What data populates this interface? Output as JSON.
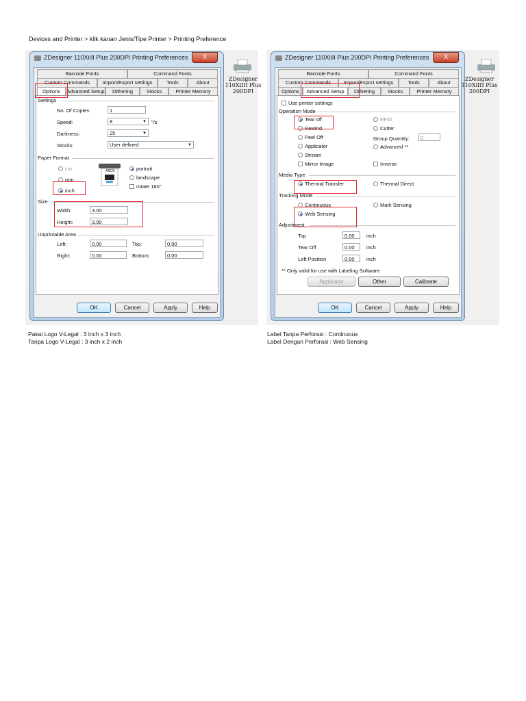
{
  "header": "Devices and Printer > klik kanan Jenis/Tipe Printer > Printing Preference",
  "left": {
    "title": "ZDesigner 110XiIII Plus 200DPI Printing Preferences",
    "close": "X",
    "printer_label": [
      "ZDesigner",
      "110XiIII Plus",
      "200DPI"
    ],
    "tabs_row1": [
      "Barcode Fonts",
      "Command Fonts"
    ],
    "tabs_row2": [
      "Custom Commands",
      "Import/Export settings",
      "Tools",
      "About"
    ],
    "tabs_row3": [
      "Options",
      "Advanced Setup",
      "Dithering",
      "Stocks",
      "Printer Memory"
    ],
    "settings": {
      "group": "Settings",
      "copies_label": "No. Of Copies:",
      "copies": "1",
      "speed_label": "Speed:",
      "speed": "8",
      "speed_unit": "\"/s",
      "darkness_label": "Darkness:",
      "darkness": "25",
      "stocks_label": "Stocks:",
      "stocks": "User defined"
    },
    "paper": {
      "group": "Paper Format",
      "cm": "cm",
      "mm": "mm",
      "inch": "inch",
      "portrait": "portrait",
      "landscape": "landscape",
      "rotate": "rotate 180°",
      "label_text": "ABCD"
    },
    "size": {
      "group": "Size",
      "width_label": "Width:",
      "width": "3.00",
      "height_label": "Height:",
      "height": "3.00"
    },
    "unprintable": {
      "group": "Unprintable Area",
      "left_label": "Left:",
      "left": "0.00",
      "top_label": "Top:",
      "top": "0.00",
      "right_label": "Right:",
      "right": "0.00",
      "bottom_label": "Bottom:",
      "bottom": "0.00"
    },
    "buttons": [
      "OK",
      "Cancel",
      "Apply",
      "Help"
    ]
  },
  "right": {
    "title": "ZDesigner 110XiIII Plus 200DPI Printing Preferences",
    "close": "X",
    "printer_label": [
      "ZDesigner",
      "110XiIII Plus",
      "200DPI"
    ],
    "tabs_row1": [
      "Barcode Fonts",
      "Command Fonts"
    ],
    "tabs_row2": [
      "Custom Commands",
      "Import/Export settings",
      "Tools",
      "About"
    ],
    "tabs_row3": [
      "Options",
      "Advanced Setup",
      "Dithering",
      "Stocks",
      "Printer Memory"
    ],
    "use_printer_settings": "Use printer settings",
    "operation": {
      "group": "Operation Mode",
      "tear_off": "Tear off",
      "rewind": "Rewind",
      "peel_off": "Peel Off",
      "applicator": "Applicator",
      "stream": "Stream",
      "mirror": "Mirror Image",
      "rfid": "RFID",
      "cutter": "Cutter",
      "group_qty_label": "Group Quantity:",
      "group_qty": "0",
      "advanced": "Advanced **",
      "inverse": "Inverse"
    },
    "media": {
      "group": "Media Type",
      "thermal_transfer": "Thermal Transfer",
      "thermal_direct": "Thermal Direct"
    },
    "tracking": {
      "group": "Tracking Mode",
      "continuous": "Continuous",
      "web_sensing": "Web Sensing",
      "mark_sensing": "Mark Sensing"
    },
    "adjustment": {
      "group": "Adjustment",
      "top_label": "Top",
      "top": "0.00",
      "tearoff_label": "Tear Off",
      "tearoff": "0.00",
      "leftpos_label": "Left Position",
      "leftpos": "0.00",
      "unit": "inch"
    },
    "footnote": "** Only valid for use with Labeling Software",
    "applicator_btn": "Applicator",
    "other_btn": "Other",
    "calibrate_btn": "Calibrate",
    "buttons": [
      "OK",
      "Cancel",
      "Apply",
      "Help"
    ]
  },
  "notes_left": [
    "Pakai Logo V-Legal  : 3 inch x 3 inch",
    "Tanpa Logo V-Legal : 3 inch x 2 inch"
  ],
  "notes_right": [
    "Label Tanpa Perforasi  :  Continuous",
    "Label Dengan Perforasi :  Web Sensing"
  ]
}
